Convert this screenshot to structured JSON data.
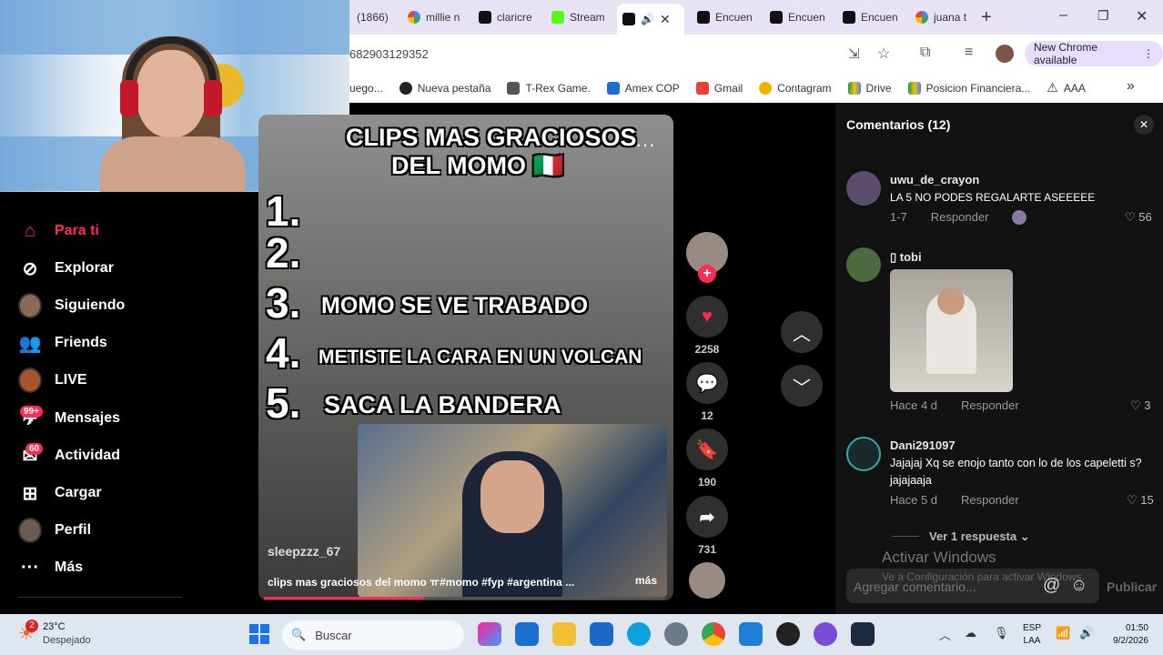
{
  "browser": {
    "tabs": [
      {
        "label": "(1866)",
        "icon": "youtube-icon"
      },
      {
        "label": "millie n",
        "icon": "google-icon"
      },
      {
        "label": "claricre",
        "icon": "tiktok-icon"
      },
      {
        "label": "Stream",
        "icon": "kick-icon"
      },
      {
        "label": "",
        "icon": "tiktok-icon",
        "active": true
      },
      {
        "label": "Encuen",
        "icon": "tiktok-icon"
      },
      {
        "label": "Encuen",
        "icon": "tiktok-icon"
      },
      {
        "label": "Encuen",
        "icon": "tiktok-icon"
      },
      {
        "label": "juana t",
        "icon": "google-icon"
      }
    ],
    "new_tab": "+",
    "url": "682903129352",
    "new_chrome": "New Chrome available",
    "bookmarks": [
      "uego...",
      "Nueva pestaña",
      "T-Rex Game.",
      "Amex COP",
      "Gmail",
      "Contagram",
      "Drive",
      "Posicion Financiera...",
      "AAA"
    ],
    "bookmarks_more": "»"
  },
  "nav": {
    "items": [
      {
        "label": "Para ti",
        "icon": "home-icon",
        "active": true
      },
      {
        "label": "Explorar",
        "icon": "compass-icon"
      },
      {
        "label": "Siguiendo",
        "icon": "following-avatar-icon"
      },
      {
        "label": "Friends",
        "icon": "friends-icon"
      },
      {
        "label": "LIVE",
        "icon": "live-avatar-icon"
      },
      {
        "label": "Mensajes",
        "icon": "messages-icon",
        "badge": "99+"
      },
      {
        "label": "Actividad",
        "icon": "activity-icon",
        "badge": "60"
      },
      {
        "label": "Cargar",
        "icon": "upload-icon"
      },
      {
        "label": "Perfil",
        "icon": "profile-avatar-icon"
      },
      {
        "label": "Más",
        "icon": "more-icon"
      }
    ]
  },
  "video": {
    "title_line1": "CLIPS MAS GRACIOSOS",
    "title_line2": "DEL MOMO 🇮🇹",
    "list": [
      {
        "num": "1.",
        "text": ""
      },
      {
        "num": "2.",
        "text": ""
      },
      {
        "num": "3.",
        "text": "MOMO SE VE TRABADO"
      },
      {
        "num": "4.",
        "text": "METISTE LA CARA EN UN VOLCAN"
      },
      {
        "num": "5.",
        "text": "SACA LA BANDERA"
      }
    ],
    "more_options": "···",
    "author": "sleepzzz_67",
    "caption": "clips mas graciosos del momo ㅠ#momo #fyp #argentina ...",
    "caption_more": "más",
    "progress": 0.4
  },
  "actions": {
    "likes": "2258",
    "comments": "12",
    "saves": "190",
    "shares": "731"
  },
  "comments": {
    "header": "Comentarios (12)",
    "list": [
      {
        "user": "uwu_de_crayon",
        "text": "LA 5 NO PODES REGALARTE ASEEEEE",
        "date": "1-7",
        "reply": "Responder",
        "likes": "56"
      },
      {
        "user": "▯ tobi",
        "text": "",
        "date": "Hace 4 d",
        "reply": "Responder",
        "likes": "3"
      },
      {
        "user": "Dani291097",
        "text": "Jajajaj Xq se enojo tanto con lo de los capeletti s? jajajaaja",
        "date": "Hace 5 d",
        "reply": "Responder",
        "likes": "15"
      }
    ],
    "view_replies": "Ver 1 respuesta",
    "input_placeholder": "Agregar comentario...",
    "publish": "Publicar",
    "watermark_title": "Activar Windows",
    "watermark_sub": "Ve a Configuración para activar Windows."
  },
  "taskbar": {
    "weather_temp": "23°C",
    "weather_desc": "Despejado",
    "weather_badge": "2",
    "search": "Buscar",
    "lang1": "ESP",
    "lang2": "LAA",
    "time": "01:50",
    "date": "9/2/2026"
  },
  "colors": {
    "accent": "#fe2c55",
    "chrome_bg": "#e8e2f5",
    "panel": "#121212"
  }
}
